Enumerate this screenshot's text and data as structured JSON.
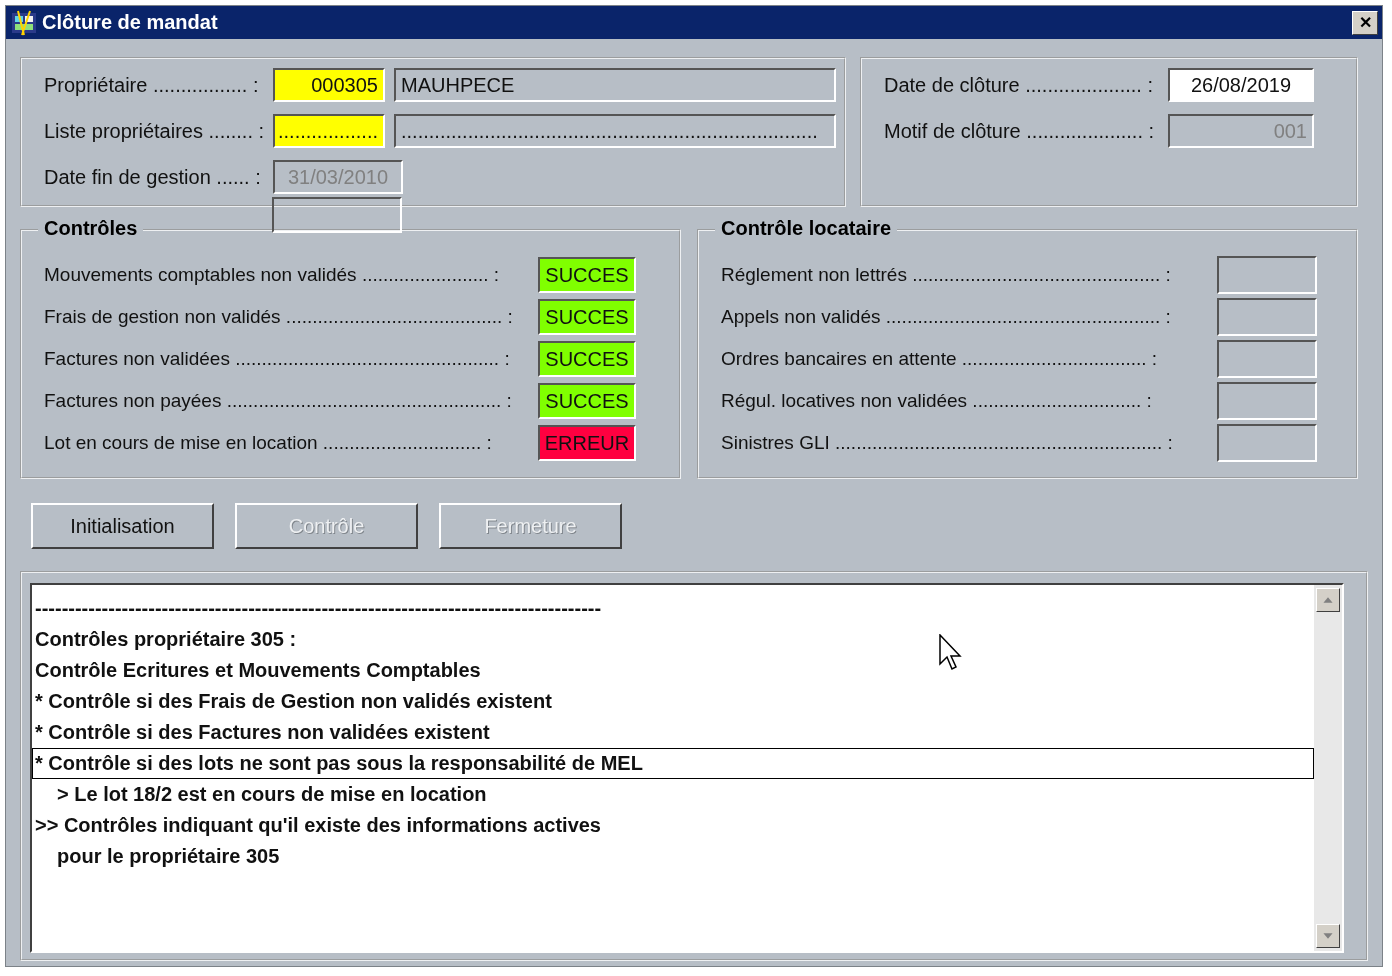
{
  "window": {
    "title": "Clôture de mandat",
    "close": "✕"
  },
  "owner_panel": {
    "rows": [
      {
        "label": "Propriétaire ................. :",
        "fields": [
          {
            "kind": "code",
            "value": "000305",
            "disabled": false
          },
          {
            "kind": "name",
            "value": "MAUHPECE",
            "disabled": false
          }
        ]
      },
      {
        "label": "Liste propriétaires ........ :",
        "fields": [
          {
            "kind": "code",
            "value": "..................",
            "disabled": false
          },
          {
            "kind": "name",
            "value": "...........................................................................",
            "disabled": false
          }
        ]
      },
      {
        "label": "Date fin de gestion ...... :",
        "fields": [
          {
            "kind": "date",
            "value": "31/03/2010",
            "disabled": true
          }
        ]
      }
    ]
  },
  "closing_panel": {
    "rows": [
      {
        "label": "Date de clôture ..................... :",
        "field": {
          "kind": "white",
          "value": "26/08/2019",
          "disabled": false
        }
      },
      {
        "label": "Motif de clôture ..................... :",
        "field": {
          "kind": "gray",
          "value": "001",
          "disabled": true
        }
      }
    ]
  },
  "controls": {
    "title": "Contrôles",
    "rows": [
      {
        "label": "Mouvements comptables non validés ........................ :",
        "status": "SUCCES",
        "color": "#80ff00"
      },
      {
        "label": "Frais de gestion non validés ......................................... :",
        "status": "SUCCES",
        "color": "#80ff00"
      },
      {
        "label": "Factures non validées .................................................. :",
        "status": "SUCCES",
        "color": "#80ff00"
      },
      {
        "label": "Factures non payées .................................................... :",
        "status": "SUCCES",
        "color": "#80ff00"
      },
      {
        "label": "Lot en cours de mise en location .............................. :",
        "status": "ERREUR",
        "color": "#ff0040"
      }
    ]
  },
  "tenant_controls": {
    "title": "Contrôle locataire",
    "rows": [
      {
        "label": "Réglement non lettrés ............................................... :"
      },
      {
        "label": "Appels non validés .................................................... :"
      },
      {
        "label": "Ordres bancaires en attente ................................... :"
      },
      {
        "label": "Régul. locatives non validées ................................ :"
      },
      {
        "label": "Sinistres GLI .............................................................. :"
      }
    ]
  },
  "buttons": [
    {
      "label": "Initialisation",
      "disabled": false
    },
    {
      "label": "Contrôle",
      "disabled": true
    },
    {
      "label": "Fermeture",
      "disabled": true
    }
  ],
  "log": {
    "lines": [
      {
        "text": "-------------------------------------------------------------------------------------",
        "kind": "plain",
        "selected": false
      },
      {
        "text": "Contrôles propriétaire 305 :",
        "kind": "plain",
        "selected": false
      },
      {
        "text": "Contrôle Ecritures et Mouvements Comptables",
        "kind": "plain",
        "selected": false
      },
      {
        "text": "* Contrôle si des Frais de Gestion non validés existent",
        "kind": "plain",
        "selected": false
      },
      {
        "text": "* Contrôle si des Factures non validées existent",
        "kind": "plain",
        "selected": false
      },
      {
        "text": "* Contrôle si des lots ne sont pas sous la responsabilité de MEL",
        "kind": "plain",
        "selected": true
      },
      {
        "text": "> Le lot 18/2 est en cours de mise en location",
        "kind": "indented",
        "selected": false
      },
      {
        "text": ">> Contrôles indiquant qu'il existe des informations actives",
        "kind": "plain",
        "selected": false
      },
      {
        "text": "pour le propriétaire 305",
        "kind": "indented",
        "selected": false
      }
    ]
  }
}
